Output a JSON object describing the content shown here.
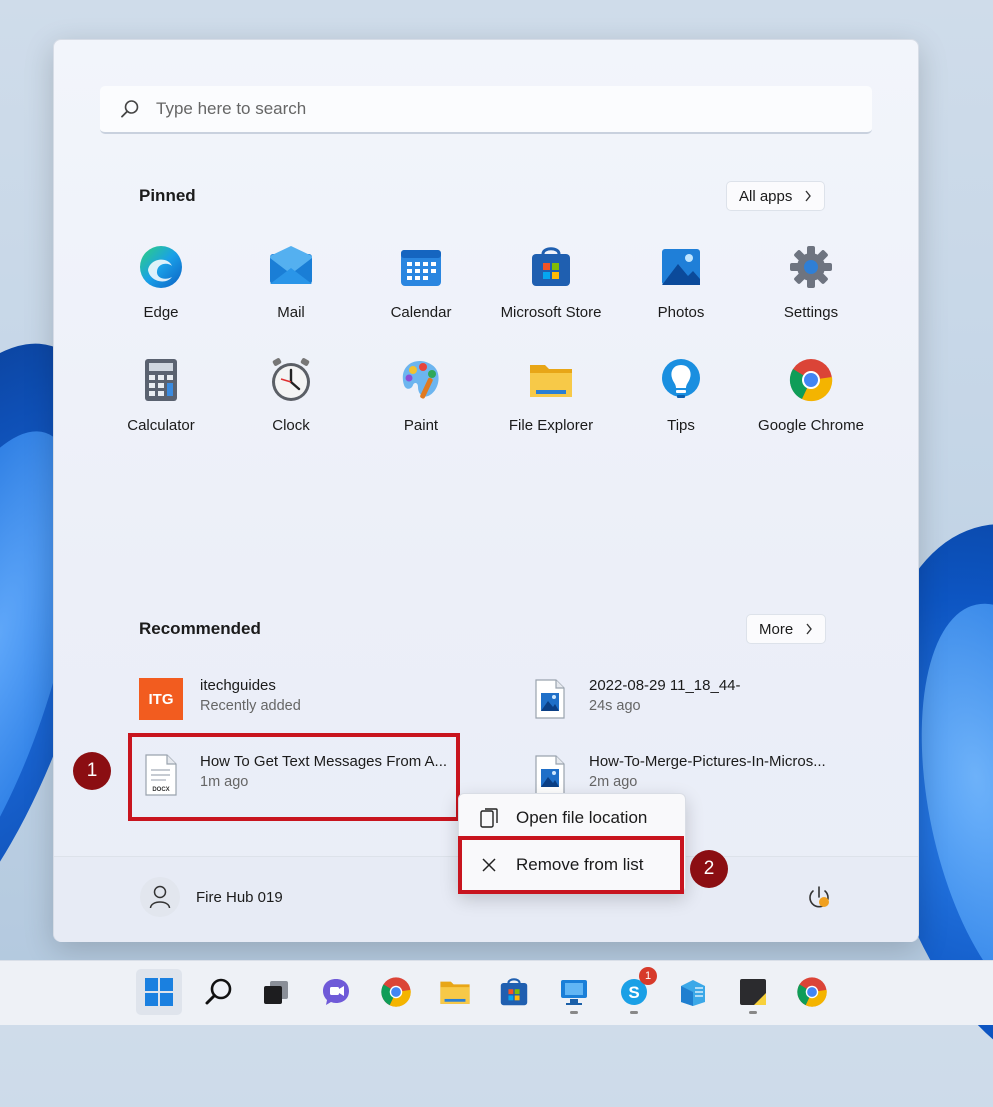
{
  "search": {
    "placeholder": "Type here to search"
  },
  "pinned": {
    "title": "Pinned",
    "all_apps_label": "All apps",
    "apps": [
      {
        "label": "Edge",
        "icon": "edge-icon"
      },
      {
        "label": "Mail",
        "icon": "mail-icon"
      },
      {
        "label": "Calendar",
        "icon": "calendar-icon"
      },
      {
        "label": "Microsoft Store",
        "icon": "store-icon"
      },
      {
        "label": "Photos",
        "icon": "photos-icon"
      },
      {
        "label": "Settings",
        "icon": "gear-icon"
      },
      {
        "label": "Calculator",
        "icon": "calculator-icon"
      },
      {
        "label": "Clock",
        "icon": "clock-icon"
      },
      {
        "label": "Paint",
        "icon": "paint-icon"
      },
      {
        "label": "File Explorer",
        "icon": "folder-icon"
      },
      {
        "label": "Tips",
        "icon": "lightbulb-icon"
      },
      {
        "label": "Google Chrome",
        "icon": "chrome-icon"
      }
    ]
  },
  "recommended": {
    "title": "Recommended",
    "more_label": "More",
    "items": [
      {
        "title": "itechguides",
        "subtitle": "Recently added",
        "icon": "itg-logo-icon",
        "logo_text": "ITG"
      },
      {
        "title": "2022-08-29 11_18_44-",
        "subtitle": "24s ago",
        "icon": "image-file-icon"
      },
      {
        "title": "How To Get Text Messages From A...",
        "subtitle": "1m ago",
        "icon": "docx-file-icon"
      },
      {
        "title": "How-To-Merge-Pictures-In-Micros...",
        "subtitle": "2m ago",
        "icon": "image-file-icon"
      }
    ]
  },
  "context_menu": {
    "items": [
      {
        "label": "Open file location",
        "icon": "file-location-icon"
      },
      {
        "label": "Remove from list",
        "icon": "close-icon"
      }
    ]
  },
  "annotations": {
    "badge1": "1",
    "badge2": "2",
    "highlight_color": "#c8141e"
  },
  "user": {
    "name": "Fire Hub 019"
  },
  "taskbar": {
    "skype_badge": "1",
    "icons": [
      "windows-start-icon",
      "search-icon",
      "task-view-icon",
      "teams-chat-icon",
      "chrome-icon",
      "file-explorer-icon",
      "store-icon",
      "remote-desktop-icon",
      "skype-icon",
      "azure-data-icon",
      "sticky-notes-icon",
      "chrome-icon"
    ]
  }
}
